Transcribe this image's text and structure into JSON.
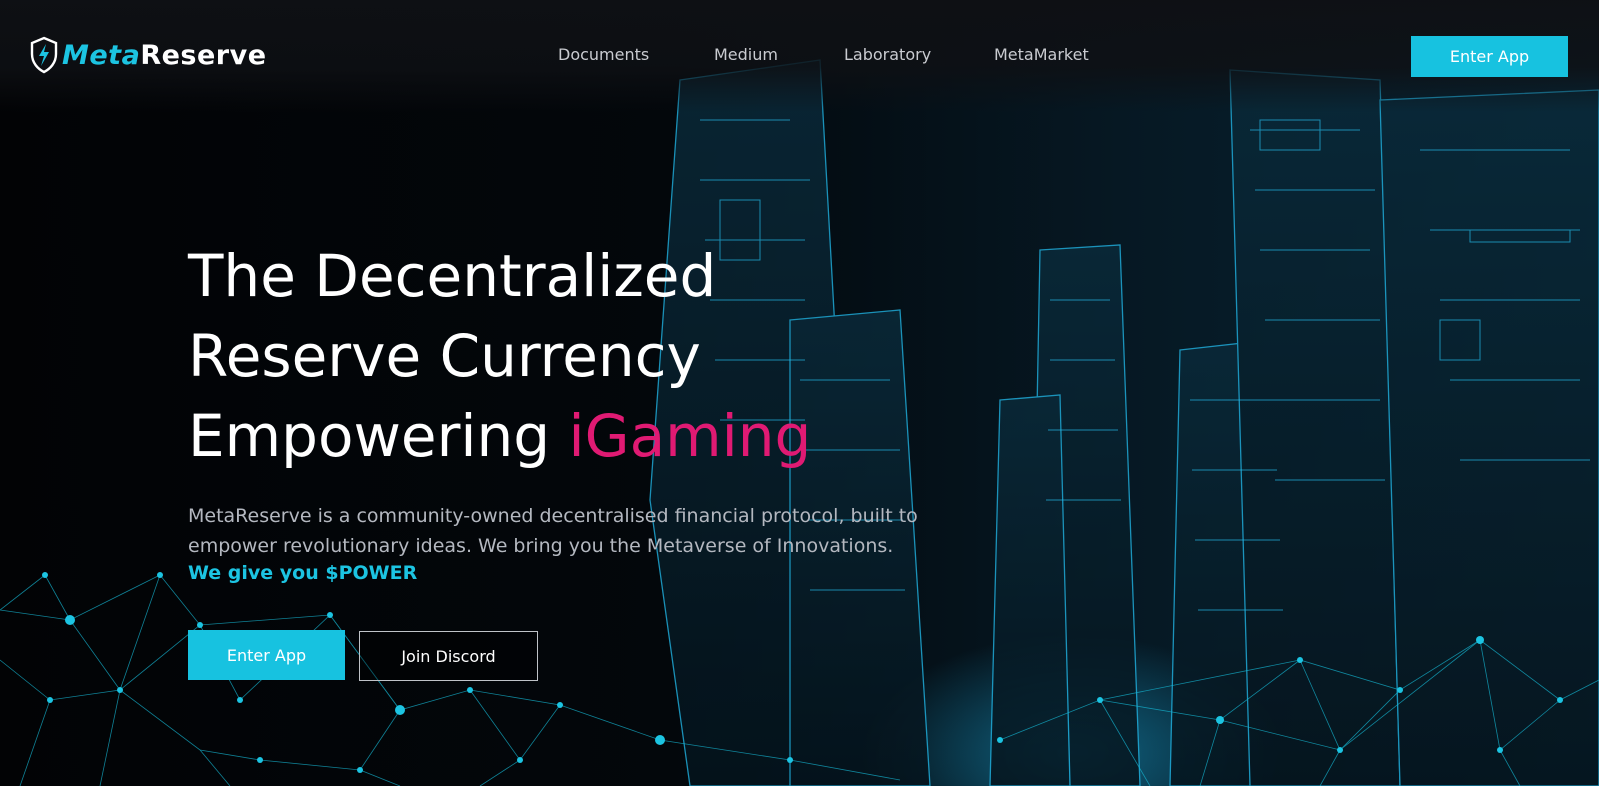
{
  "brand": {
    "name_part1": "Meta",
    "name_part2": "Reserve",
    "logo_icon": "shield-lightning-icon",
    "accent_color": "#1cc4e2"
  },
  "nav": {
    "items": [
      {
        "label": "Documents"
      },
      {
        "label": "Medium"
      },
      {
        "label": "Laboratory"
      },
      {
        "label": "MetaMarket"
      }
    ],
    "cta_label": "Enter App"
  },
  "hero": {
    "title_line1": "The Decentralized",
    "title_line2": "Reserve Currency",
    "title_line3_prefix": "Empowering ",
    "title_highlight": "iGaming",
    "highlight_color": "#e01a73",
    "description": "MetaReserve is a community-owned decentralised financial protocol, built to empower revolutionary ideas. We bring you the Metaverse of Innovations.",
    "tagline": "We give you $POWER",
    "primary_button": "Enter App",
    "secondary_button": "Join Discord"
  }
}
